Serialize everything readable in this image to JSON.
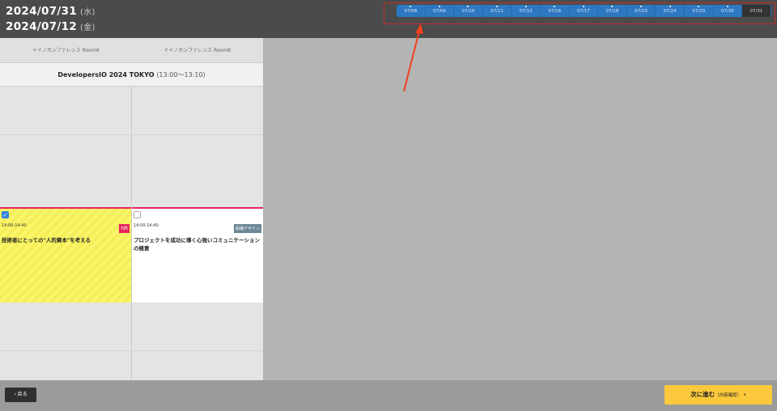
{
  "header": {
    "dates": [
      {
        "date": "2024/07/31",
        "dow": "(水)"
      },
      {
        "date": "2024/07/12",
        "dow": "(金)"
      }
    ]
  },
  "date_tabs": [
    "07/08",
    "07/09",
    "07/10",
    "07/11",
    "07/12",
    "07/16",
    "07/17",
    "07/18",
    "07/23",
    "07/24",
    "07/29",
    "07/30",
    "07/31"
  ],
  "active_tab": "07/31",
  "rooms": [
    "イイノカンファレンス RoomA",
    "イイノカンファレンス RoomB"
  ],
  "event": {
    "name": "DevelopersIO 2024 TOKYO",
    "time": "(13:00〜13:10)"
  },
  "sessions": [
    {
      "checked": true,
      "time": "14:00-14:40",
      "badge": "HR",
      "badge_color": "#e8245e",
      "title": "技術者にとっての\"人的資本\"を考える"
    },
    {
      "checked": false,
      "time": "14:00-14:40",
      "badge": "組織デザイン",
      "badge_color": "#6b8796",
      "title": "プロジェクトを成功に導く心強いコミュニケーションの極意"
    }
  ],
  "footer": {
    "back": "戻る",
    "next": "次に進む",
    "next_sub": "（内容確認）"
  }
}
